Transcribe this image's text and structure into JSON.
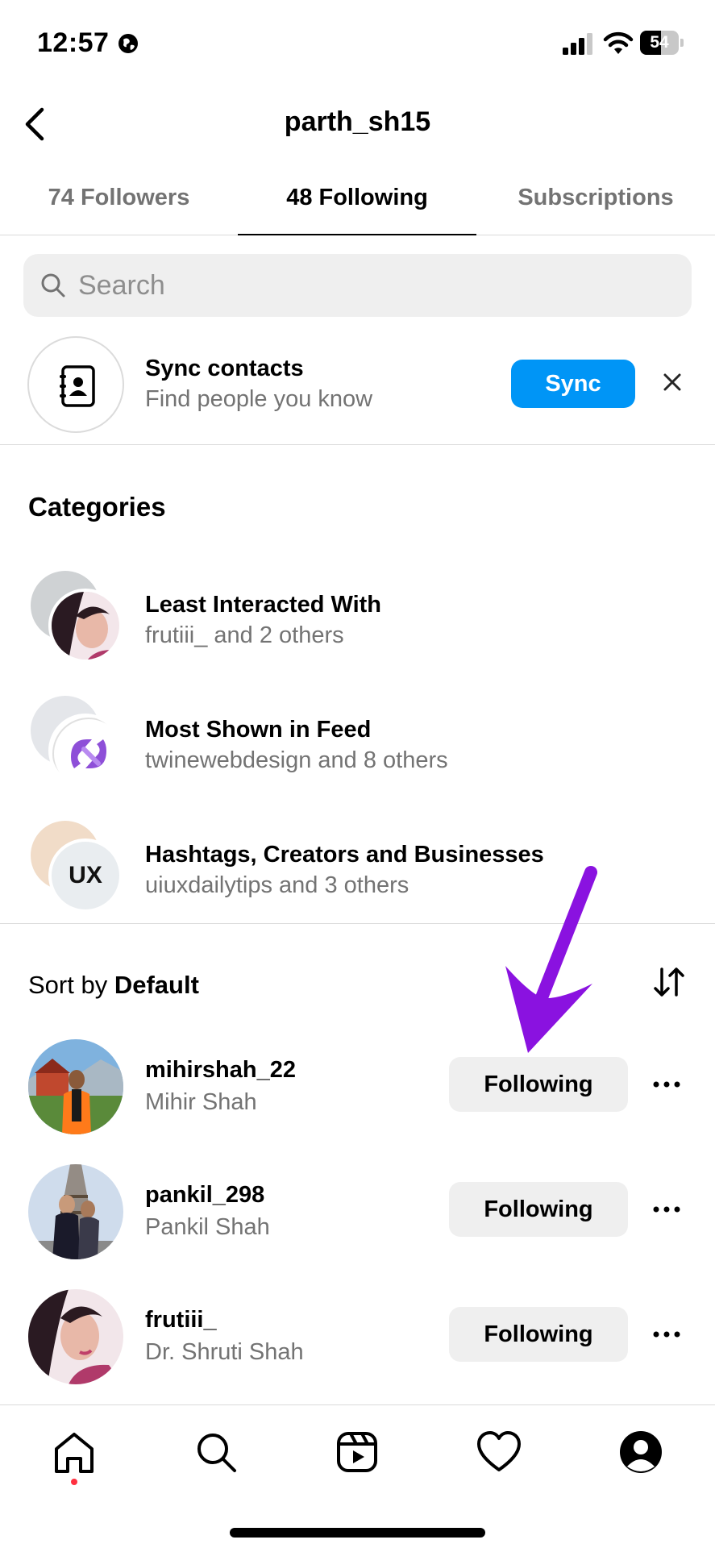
{
  "status_bar": {
    "time": "12:57",
    "battery": "54",
    "battery_level_fraction": 0.54
  },
  "header": {
    "title": "parth_sh15",
    "back_icon": "chevron-left-icon"
  },
  "tabs": [
    {
      "label": "74 Followers",
      "active": false
    },
    {
      "label": "48 Following",
      "active": true
    },
    {
      "label": "Subscriptions",
      "active": false
    }
  ],
  "search": {
    "placeholder": "Search",
    "value": ""
  },
  "sync": {
    "title": "Sync contacts",
    "subtitle": "Find people you know",
    "button_label": "Sync",
    "icon": "contacts-book-icon"
  },
  "categories": {
    "heading": "Categories",
    "items": [
      {
        "title": "Least Interacted With",
        "subtitle": "frutiii_ and 2 others"
      },
      {
        "title": "Most Shown in Feed",
        "subtitle": "twinewebdesign and 8 others"
      },
      {
        "title": "Hashtags, Creators and Businesses",
        "subtitle": "uiuxdailytips and 3 others",
        "badge": "UX"
      }
    ]
  },
  "sort": {
    "prefix": "Sort by",
    "value": "Default"
  },
  "users": [
    {
      "username": "mihirshah_22",
      "full_name": "Mihir Shah",
      "button_label": "Following"
    },
    {
      "username": "pankil_298",
      "full_name": "Pankil Shah",
      "button_label": "Following"
    },
    {
      "username": "frutiii_",
      "full_name": "Dr. Shruti Shah",
      "button_label": "Following"
    }
  ],
  "tabbar": [
    "home-icon",
    "search-icon",
    "reels-icon",
    "heart-icon",
    "profile-icon"
  ],
  "colors": {
    "accent": "#0095f6",
    "annotation_arrow": "#8a12e0",
    "notification_dot": "#ff3040"
  }
}
